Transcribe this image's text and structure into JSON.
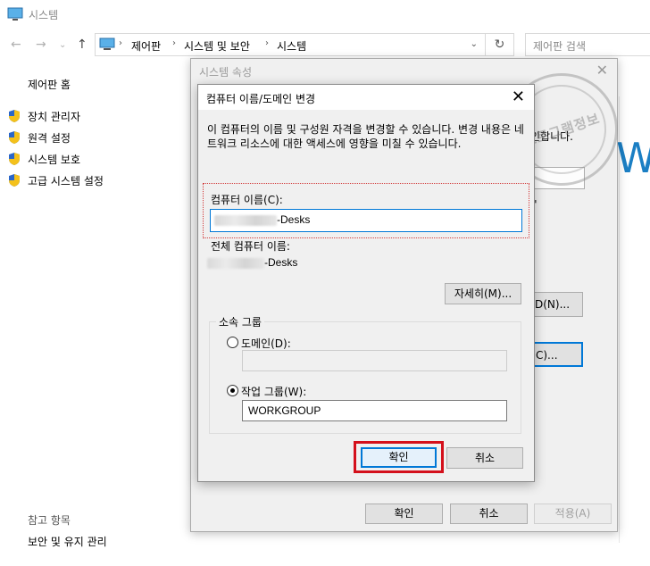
{
  "window": {
    "title": "시스템"
  },
  "address": {
    "crumbs": [
      "제어판",
      "시스템 및 보안",
      "시스템"
    ],
    "search_placeholder": "제어판 검색"
  },
  "sidebar": {
    "home": "제어판 홈",
    "links": [
      "장치 관리자",
      "원격 설정",
      "시스템 보호",
      "고급 시스템 설정"
    ],
    "see_also": "참고 항목",
    "security": "보안 및 유지 관리"
  },
  "background": {
    "brand_letter": "W",
    "frag_1": "인합니다.",
    "frag_2": "\"",
    "frag_3": "D(N)...",
    "frag_4": "C)..."
  },
  "system_properties": {
    "title": "시스템 속성",
    "ok": "확인",
    "cancel": "취소",
    "apply": "적용(A)"
  },
  "dialog": {
    "title": "컴퓨터 이름/도메인 변경",
    "description": "이 컴퓨터의 이름 및 구성원 자격을 변경할 수 있습니다. 변경 내용은 네트워크 리소스에 대한 액세스에 영향을 미칠 수 있습니다.",
    "computer_name_label": "컴퓨터 이름(C):",
    "computer_name_suffix": "-Desks",
    "full_name_label": "전체 컴퓨터 이름:",
    "full_name_suffix": "-Desks",
    "more_button": "자세히(M)...",
    "member_of": "소속 그룹",
    "domain_label": "도메인(D):",
    "domain_value": "",
    "workgroup_label": "작업 그룹(W):",
    "workgroup_value": "WORKGROUP",
    "ok": "확인",
    "cancel": "취소"
  },
  "watermark": {
    "text": "프로그램정보"
  },
  "colors": {
    "highlight_red": "#d4101b",
    "accent_blue": "#0078d7"
  }
}
